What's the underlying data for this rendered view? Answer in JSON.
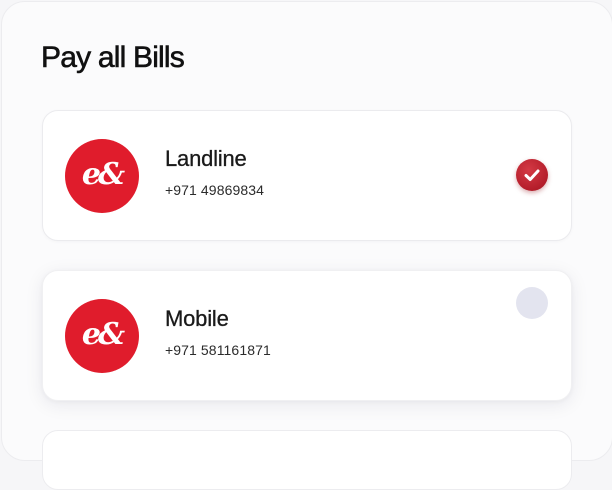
{
  "page": {
    "title": "Pay all Bills"
  },
  "bills": [
    {
      "name": "Landline",
      "number": "+971 49869834",
      "logo_text": "e&",
      "selected": true
    },
    {
      "name": "Mobile",
      "number": "+971 581161871",
      "logo_text": "e&",
      "selected": false
    }
  ],
  "colors": {
    "brand_red": "#e01c2c",
    "check_red": "#b41d2a",
    "radio_off": "#e3e4ef"
  },
  "icons": {
    "selected": "checkmark-circle-icon",
    "unselected": "radio-empty-icon"
  }
}
